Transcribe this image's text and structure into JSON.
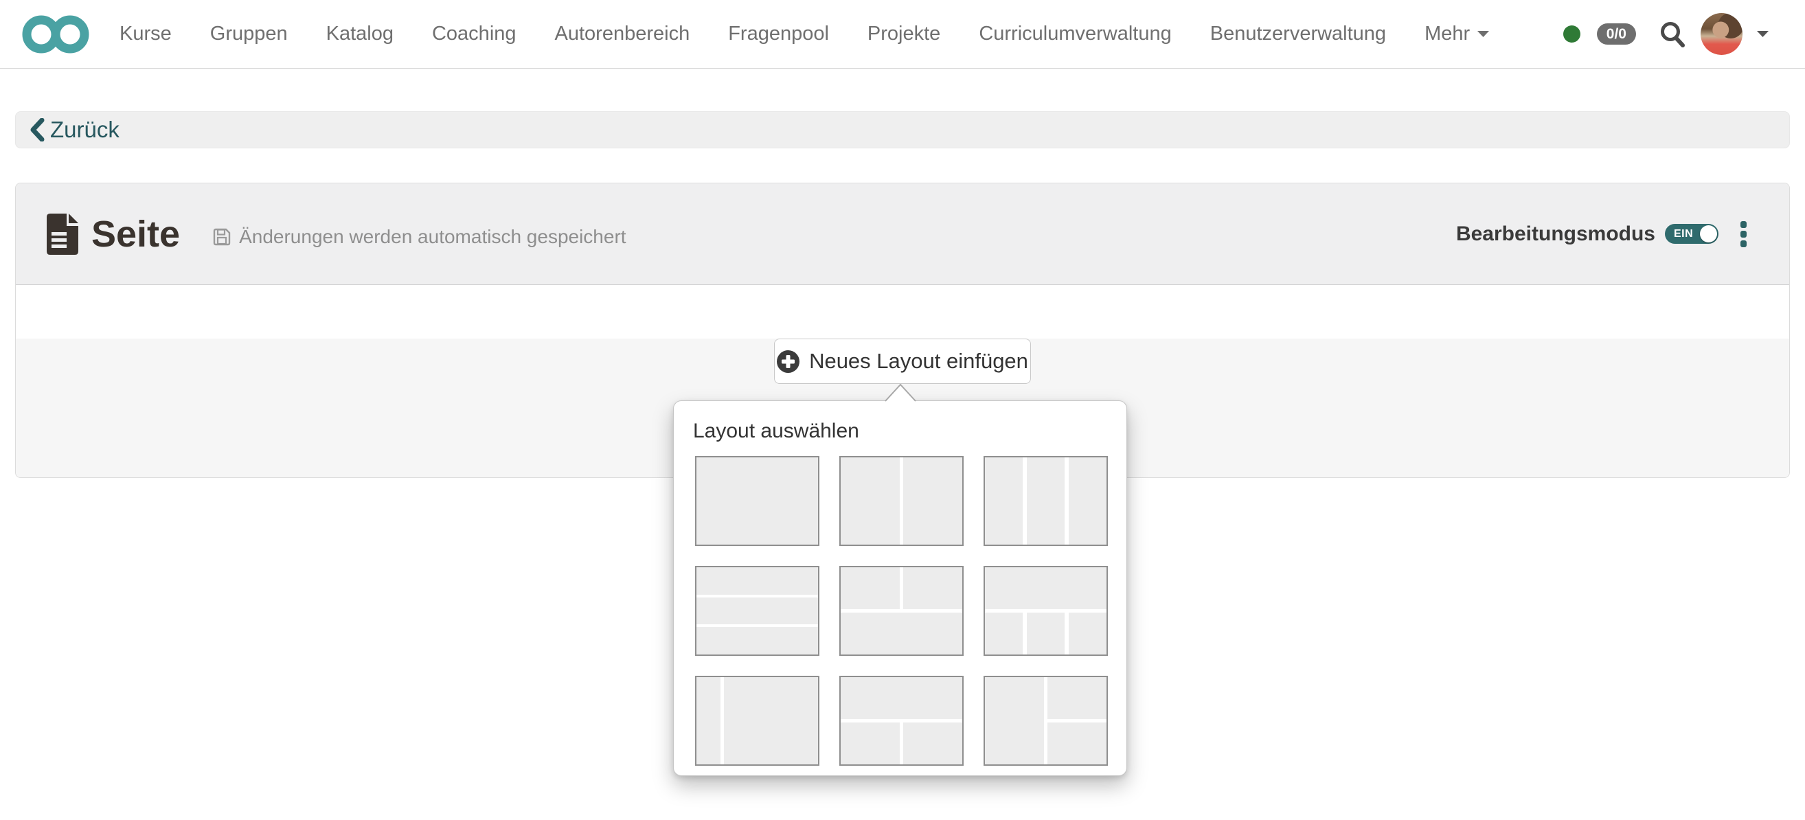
{
  "navbar": {
    "items": [
      "Kurse",
      "Gruppen",
      "Katalog",
      "Coaching",
      "Autorenbereich",
      "Fragenpool",
      "Projekte",
      "Curriculumverwaltung",
      "Benutzerverwaltung"
    ],
    "more_label": "Mehr",
    "status_badge": "0/0"
  },
  "breadcrumb": {
    "back_label": "Zurück"
  },
  "page": {
    "title": "Seite",
    "autosave_note": "Änderungen werden automatisch gespeichert",
    "edit_mode_label": "Bearbeitungsmodus",
    "toggle_on_label": "EIN"
  },
  "content": {
    "insert_button_label": "Neues Layout einfügen"
  },
  "popover": {
    "title": "Layout auswählen",
    "layouts": [
      {
        "name": "1-column",
        "cells": [
          [
            0,
            0,
            100,
            100
          ]
        ]
      },
      {
        "name": "2-columns",
        "cells": [
          [
            0,
            0,
            48.6,
            100
          ],
          [
            51.4,
            0,
            48.6,
            100
          ]
        ]
      },
      {
        "name": "3-columns",
        "cells": [
          [
            0,
            0,
            31.2,
            100
          ],
          [
            34.4,
            0,
            31.2,
            100
          ],
          [
            68.8,
            0,
            31.2,
            100
          ]
        ]
      },
      {
        "name": "3-rows",
        "cells": [
          [
            0,
            0,
            100,
            31.2
          ],
          [
            0,
            34.4,
            100,
            31.2
          ],
          [
            0,
            68.8,
            100,
            31.2
          ]
        ]
      },
      {
        "name": "2-columns-over-row",
        "cells": [
          [
            0,
            0,
            48.6,
            48
          ],
          [
            51.4,
            0,
            48.6,
            48
          ],
          [
            0,
            52,
            100,
            48
          ]
        ]
      },
      {
        "name": "row-over-3-columns",
        "cells": [
          [
            0,
            0,
            100,
            48
          ],
          [
            0,
            52,
            31.2,
            48
          ],
          [
            34.4,
            52,
            31.2,
            48
          ],
          [
            68.8,
            52,
            31.2,
            48
          ]
        ]
      },
      {
        "name": "narrow-left-column",
        "cells": [
          [
            0,
            0,
            19.5,
            100
          ],
          [
            22.5,
            0,
            77.5,
            100
          ]
        ]
      },
      {
        "name": "row-over-2-columns",
        "cells": [
          [
            0,
            0,
            100,
            48
          ],
          [
            0,
            52,
            48.6,
            48
          ],
          [
            51.4,
            52,
            48.6,
            48
          ]
        ]
      },
      {
        "name": "column-and-2-rows",
        "cells": [
          [
            0,
            0,
            48.6,
            100
          ],
          [
            51.4,
            0,
            48.6,
            48
          ],
          [
            51.4,
            52,
            48.6,
            48
          ]
        ]
      }
    ]
  },
  "icons": [
    "openolat-logo",
    "status-dot",
    "search-icon",
    "avatar",
    "caret-down-icon",
    "chevron-left-icon",
    "document-icon",
    "save-icon",
    "kebab-menu-icon",
    "plus-circle-icon"
  ],
  "colors": {
    "brand_teal": "#4aa2a3",
    "dark_teal_link": "#27585f",
    "toggle_teal": "#2f6b6d",
    "status_green": "#2f7a36",
    "badge_gray": "#6e6e6e",
    "title_dark": "#3a332e",
    "header_bg": "#efeff0",
    "body_bg": "#f6f6f6"
  }
}
